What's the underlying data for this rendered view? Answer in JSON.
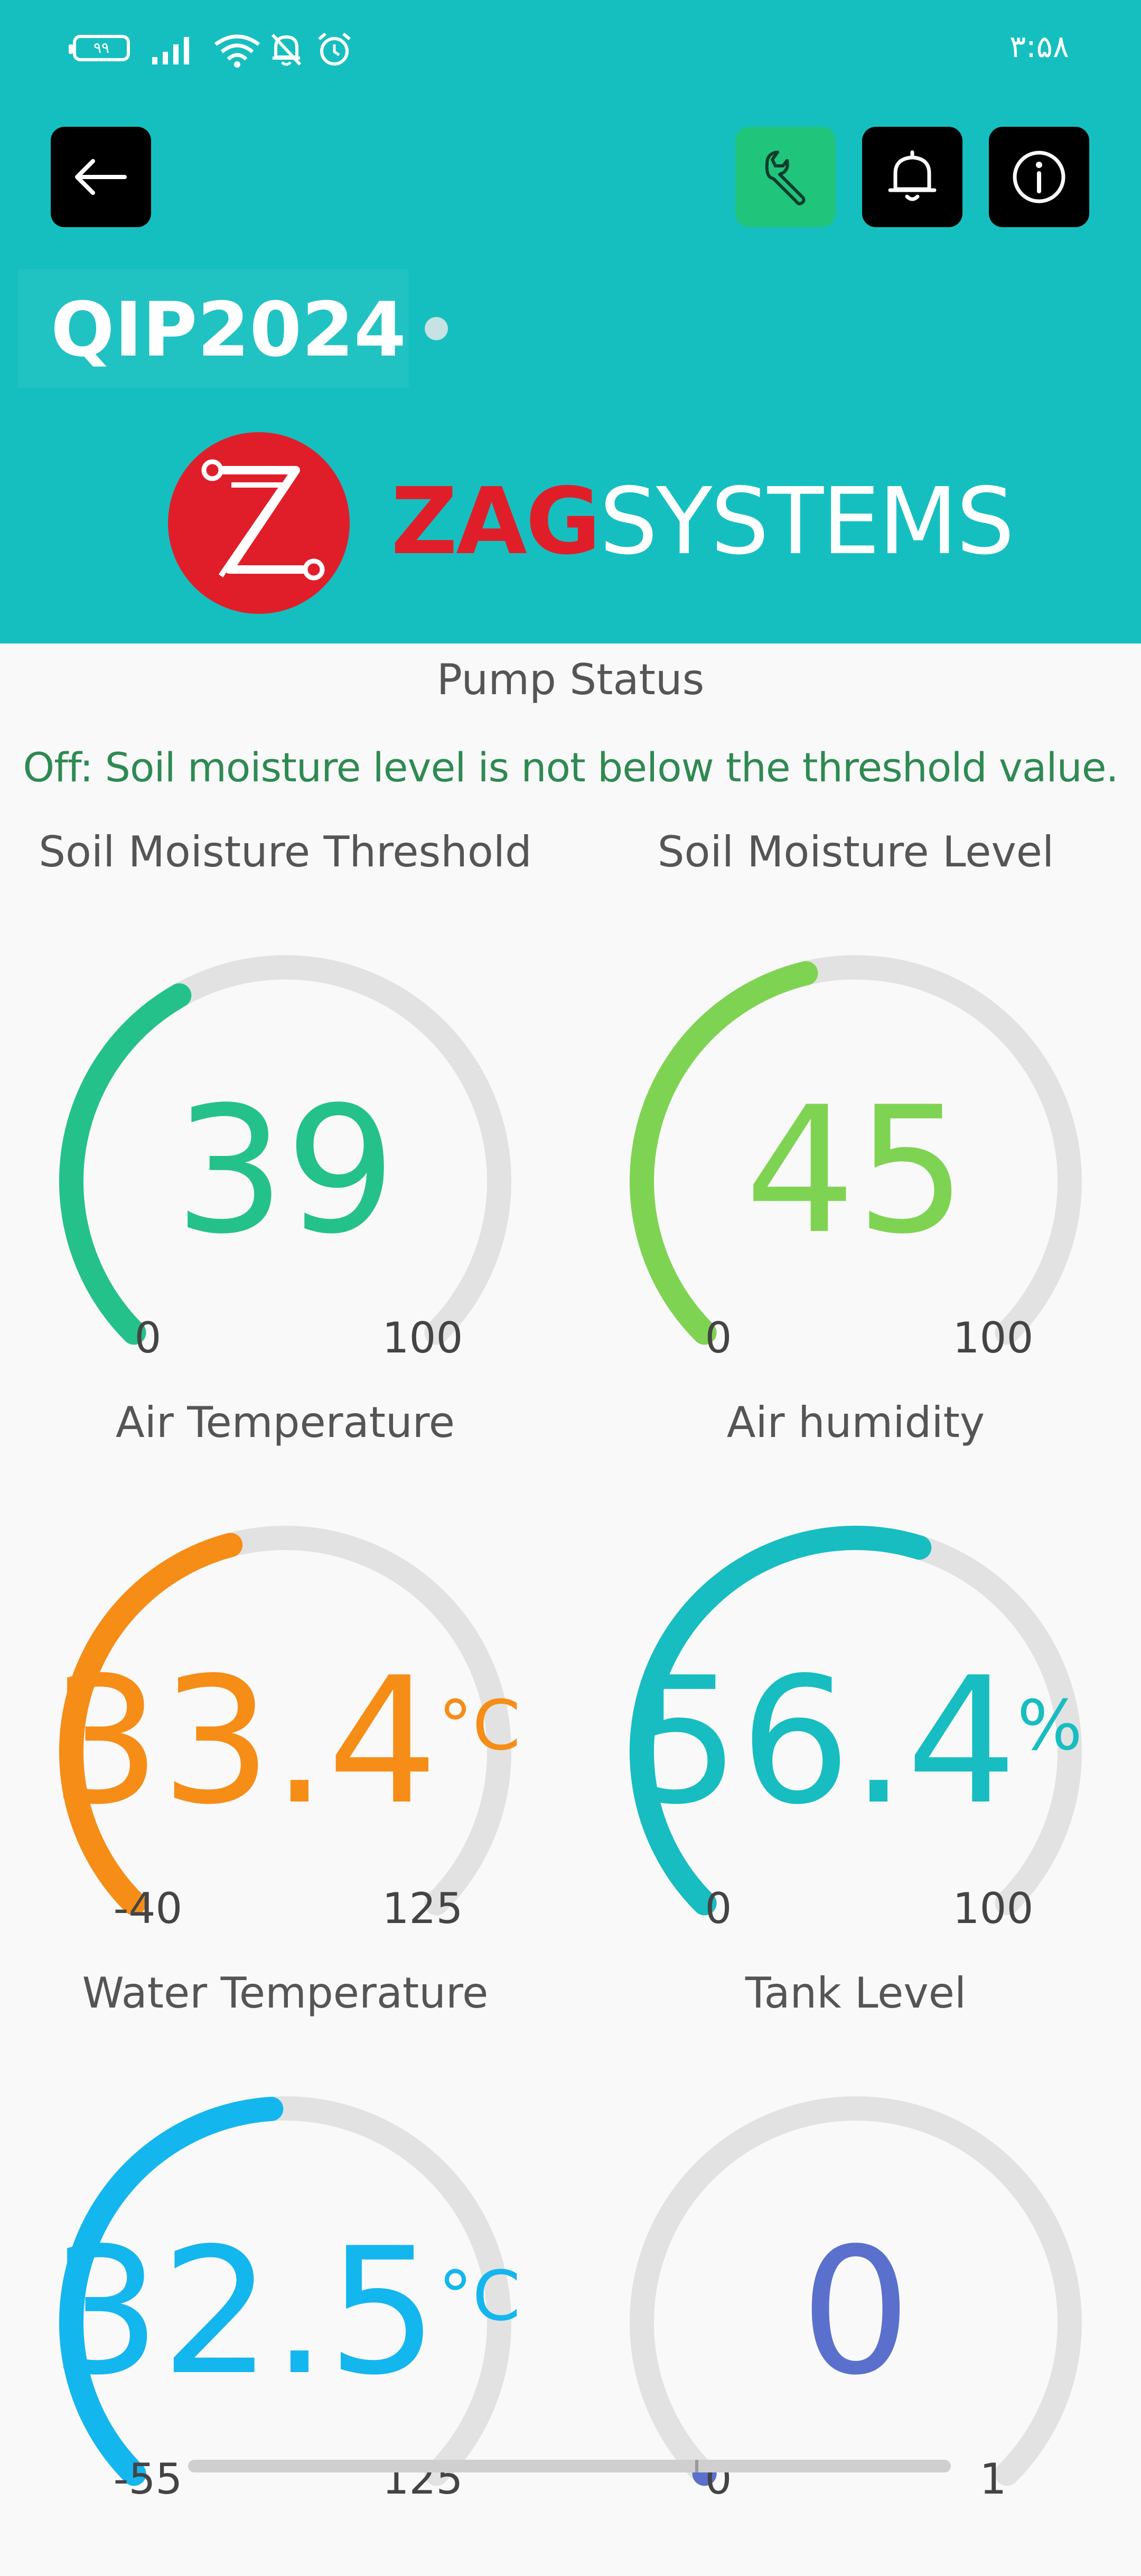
{
  "status_bar": {
    "time": "۳:۵۸",
    "battery": "۹۹"
  },
  "device": {
    "name": "QIP2024"
  },
  "logo": {
    "brand_part1": "ZAG",
    "brand_part2": "SYSTEMS"
  },
  "pump": {
    "label": "Pump Status",
    "message": "Off: Soil moisture level is not below the threshold value."
  },
  "gauges": [
    {
      "title": "Soil Moisture Threshold",
      "value": "39",
      "unit": "",
      "min": "0",
      "max": "100",
      "fraction": 0.39,
      "color": "#25c18a"
    },
    {
      "title": "Soil Moisture Level",
      "value": "45",
      "unit": "",
      "min": "0",
      "max": "100",
      "fraction": 0.45,
      "color": "#7fd352"
    },
    {
      "title": "Air Temperature",
      "value": "33.4",
      "unit": "°C",
      "min": "-40",
      "max": "125",
      "fraction": 0.445,
      "color": "#f58d17"
    },
    {
      "title": "Air humidity",
      "value": "56.4",
      "unit": "%",
      "min": "0",
      "max": "100",
      "fraction": 0.564,
      "color": "#17bdc0"
    },
    {
      "title": "Water Temperature",
      "value": "32.5",
      "unit": "°C",
      "min": "-55",
      "max": "125",
      "fraction": 0.486,
      "color": "#14b6ee"
    },
    {
      "title": "Tank Level",
      "value": "0",
      "unit": "",
      "min": "0",
      "max": "1",
      "fraction": 0.0,
      "color": "#5a70cc"
    }
  ],
  "colors": {
    "header_bg": "#16bfbf",
    "track": "#e2e2e2",
    "pump_message": "#2e8a52",
    "logo_red": "#e01e2a"
  },
  "icons": [
    "back-arrow-icon",
    "wrench-icon",
    "bell-icon",
    "info-icon",
    "battery-icon",
    "signal-icon",
    "wifi-icon",
    "bell-off-icon",
    "alarm-icon"
  ]
}
